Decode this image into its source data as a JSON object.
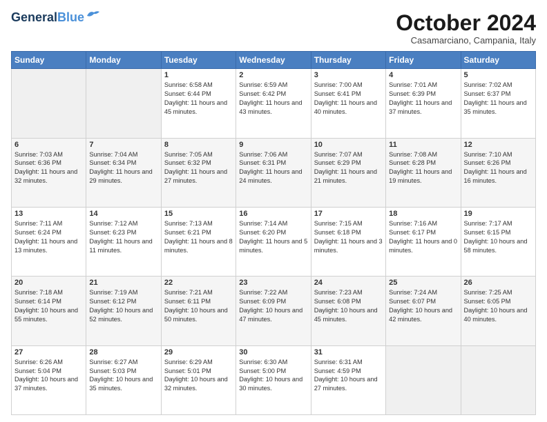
{
  "logo": {
    "line1": "General",
    "line2": "Blue"
  },
  "header": {
    "month": "October 2024",
    "location": "Casamarciano, Campania, Italy"
  },
  "days_of_week": [
    "Sunday",
    "Monday",
    "Tuesday",
    "Wednesday",
    "Thursday",
    "Friday",
    "Saturday"
  ],
  "weeks": [
    [
      {
        "day": "",
        "info": ""
      },
      {
        "day": "",
        "info": ""
      },
      {
        "day": "1",
        "info": "Sunrise: 6:58 AM\nSunset: 6:44 PM\nDaylight: 11 hours and 45 minutes."
      },
      {
        "day": "2",
        "info": "Sunrise: 6:59 AM\nSunset: 6:42 PM\nDaylight: 11 hours and 43 minutes."
      },
      {
        "day": "3",
        "info": "Sunrise: 7:00 AM\nSunset: 6:41 PM\nDaylight: 11 hours and 40 minutes."
      },
      {
        "day": "4",
        "info": "Sunrise: 7:01 AM\nSunset: 6:39 PM\nDaylight: 11 hours and 37 minutes."
      },
      {
        "day": "5",
        "info": "Sunrise: 7:02 AM\nSunset: 6:37 PM\nDaylight: 11 hours and 35 minutes."
      }
    ],
    [
      {
        "day": "6",
        "info": "Sunrise: 7:03 AM\nSunset: 6:36 PM\nDaylight: 11 hours and 32 minutes."
      },
      {
        "day": "7",
        "info": "Sunrise: 7:04 AM\nSunset: 6:34 PM\nDaylight: 11 hours and 29 minutes."
      },
      {
        "day": "8",
        "info": "Sunrise: 7:05 AM\nSunset: 6:32 PM\nDaylight: 11 hours and 27 minutes."
      },
      {
        "day": "9",
        "info": "Sunrise: 7:06 AM\nSunset: 6:31 PM\nDaylight: 11 hours and 24 minutes."
      },
      {
        "day": "10",
        "info": "Sunrise: 7:07 AM\nSunset: 6:29 PM\nDaylight: 11 hours and 21 minutes."
      },
      {
        "day": "11",
        "info": "Sunrise: 7:08 AM\nSunset: 6:28 PM\nDaylight: 11 hours and 19 minutes."
      },
      {
        "day": "12",
        "info": "Sunrise: 7:10 AM\nSunset: 6:26 PM\nDaylight: 11 hours and 16 minutes."
      }
    ],
    [
      {
        "day": "13",
        "info": "Sunrise: 7:11 AM\nSunset: 6:24 PM\nDaylight: 11 hours and 13 minutes."
      },
      {
        "day": "14",
        "info": "Sunrise: 7:12 AM\nSunset: 6:23 PM\nDaylight: 11 hours and 11 minutes."
      },
      {
        "day": "15",
        "info": "Sunrise: 7:13 AM\nSunset: 6:21 PM\nDaylight: 11 hours and 8 minutes."
      },
      {
        "day": "16",
        "info": "Sunrise: 7:14 AM\nSunset: 6:20 PM\nDaylight: 11 hours and 5 minutes."
      },
      {
        "day": "17",
        "info": "Sunrise: 7:15 AM\nSunset: 6:18 PM\nDaylight: 11 hours and 3 minutes."
      },
      {
        "day": "18",
        "info": "Sunrise: 7:16 AM\nSunset: 6:17 PM\nDaylight: 11 hours and 0 minutes."
      },
      {
        "day": "19",
        "info": "Sunrise: 7:17 AM\nSunset: 6:15 PM\nDaylight: 10 hours and 58 minutes."
      }
    ],
    [
      {
        "day": "20",
        "info": "Sunrise: 7:18 AM\nSunset: 6:14 PM\nDaylight: 10 hours and 55 minutes."
      },
      {
        "day": "21",
        "info": "Sunrise: 7:19 AM\nSunset: 6:12 PM\nDaylight: 10 hours and 52 minutes."
      },
      {
        "day": "22",
        "info": "Sunrise: 7:21 AM\nSunset: 6:11 PM\nDaylight: 10 hours and 50 minutes."
      },
      {
        "day": "23",
        "info": "Sunrise: 7:22 AM\nSunset: 6:09 PM\nDaylight: 10 hours and 47 minutes."
      },
      {
        "day": "24",
        "info": "Sunrise: 7:23 AM\nSunset: 6:08 PM\nDaylight: 10 hours and 45 minutes."
      },
      {
        "day": "25",
        "info": "Sunrise: 7:24 AM\nSunset: 6:07 PM\nDaylight: 10 hours and 42 minutes."
      },
      {
        "day": "26",
        "info": "Sunrise: 7:25 AM\nSunset: 6:05 PM\nDaylight: 10 hours and 40 minutes."
      }
    ],
    [
      {
        "day": "27",
        "info": "Sunrise: 6:26 AM\nSunset: 5:04 PM\nDaylight: 10 hours and 37 minutes."
      },
      {
        "day": "28",
        "info": "Sunrise: 6:27 AM\nSunset: 5:03 PM\nDaylight: 10 hours and 35 minutes."
      },
      {
        "day": "29",
        "info": "Sunrise: 6:29 AM\nSunset: 5:01 PM\nDaylight: 10 hours and 32 minutes."
      },
      {
        "day": "30",
        "info": "Sunrise: 6:30 AM\nSunset: 5:00 PM\nDaylight: 10 hours and 30 minutes."
      },
      {
        "day": "31",
        "info": "Sunrise: 6:31 AM\nSunset: 4:59 PM\nDaylight: 10 hours and 27 minutes."
      },
      {
        "day": "",
        "info": ""
      },
      {
        "day": "",
        "info": ""
      }
    ]
  ]
}
